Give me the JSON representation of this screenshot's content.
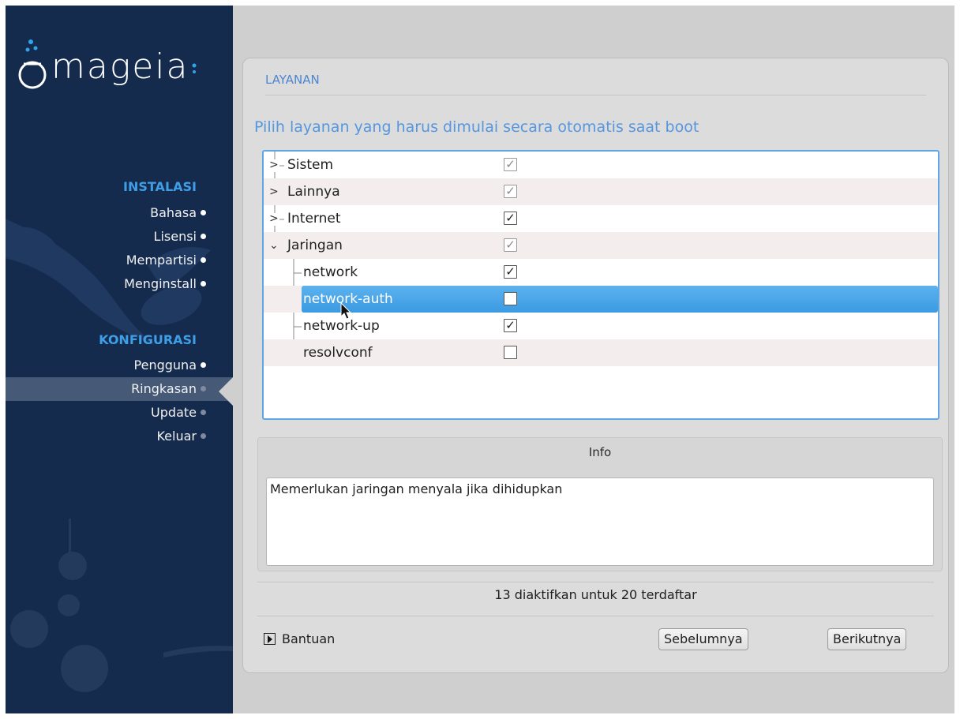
{
  "sidebar": {
    "brand": "mageia",
    "sections": [
      {
        "title": "INSTALASI",
        "items": [
          "Bahasa",
          "Lisensi",
          "Mempartisi",
          "Menginstall"
        ]
      },
      {
        "title": "KONFIGURASI",
        "items": [
          "Pengguna",
          "Ringkasan",
          "Update",
          "Keluar"
        ]
      }
    ],
    "active_item": "Ringkasan"
  },
  "page": {
    "title": "LAYANAN",
    "subtitle": "Pilih layanan yang harus dimulai secara otomatis saat boot"
  },
  "services_tree": {
    "rows": [
      {
        "label": "Sistem",
        "type": "group",
        "expanded": false,
        "checked": true,
        "greyed": true
      },
      {
        "label": "Lainnya",
        "type": "group",
        "expanded": false,
        "checked": true,
        "greyed": true
      },
      {
        "label": "Internet",
        "type": "group",
        "expanded": false,
        "checked": true,
        "greyed": false
      },
      {
        "label": "Jaringan",
        "type": "group",
        "expanded": true,
        "checked": true,
        "greyed": true
      },
      {
        "label": "network",
        "type": "child",
        "checked": true,
        "greyed": false
      },
      {
        "label": "network-auth",
        "type": "child",
        "checked": false,
        "greyed": false,
        "selected": true
      },
      {
        "label": "network-up",
        "type": "child",
        "checked": true,
        "greyed": false
      },
      {
        "label": "resolvconf",
        "type": "child",
        "checked": false,
        "greyed": false
      }
    ]
  },
  "info": {
    "title": "Info",
    "text": "Memerlukan jaringan menyala jika dihidupkan"
  },
  "status": "13 diaktifkan untuk 20 terdaftar",
  "buttons": {
    "help": "Bantuan",
    "previous": "Sebelumnya",
    "next": "Berikutnya"
  },
  "colors": {
    "sidebar_bg": "#152b4e",
    "section_title": "#3f9ee6",
    "selection": "#3b9ae2",
    "heading": "#4d86d0"
  }
}
